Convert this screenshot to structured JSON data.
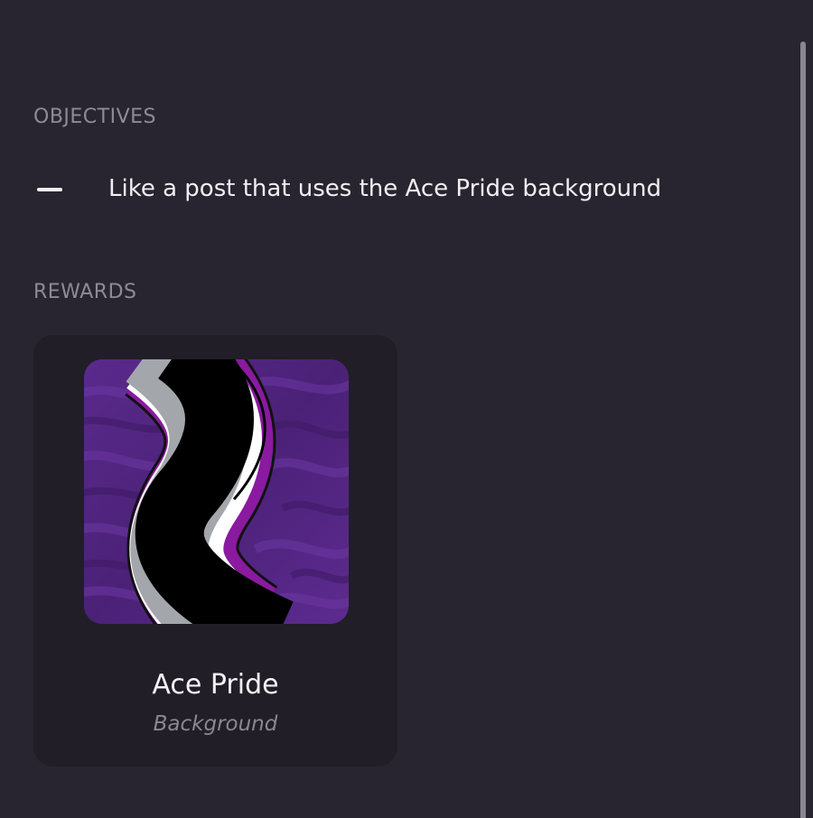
{
  "objectives": {
    "heading": "OBJECTIVES",
    "items": [
      {
        "text": "Like a post that uses the Ace Pride background",
        "status_icon": "dash-icon"
      }
    ]
  },
  "rewards": {
    "heading": "REWARDS",
    "items": [
      {
        "title": "Ace Pride",
        "type": "Background",
        "thumbnail_icon": "ace-pride-flag-ribbon",
        "colors": {
          "purple": "#5a2a8a",
          "black": "#000000",
          "grey": "#a3a6ab",
          "white": "#ffffff",
          "ribbon_purple": "#8a1aa0"
        }
      }
    ]
  },
  "theme": {
    "background": "#292530",
    "card": "#211e27",
    "heading_text": "#8e8a96",
    "body_text": "#f1eff4",
    "muted_text": "#8b8792",
    "scrollbar": "#8a8790"
  }
}
